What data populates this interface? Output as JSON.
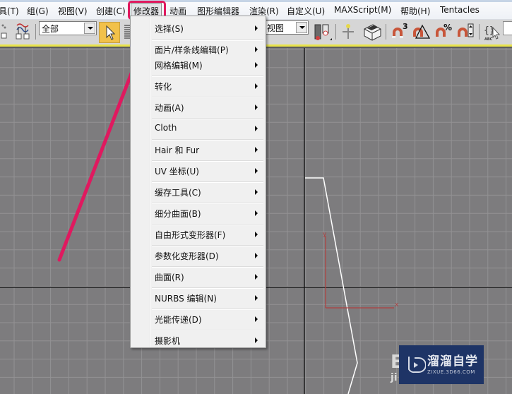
{
  "menubar": {
    "items": [
      {
        "label": "具(T)",
        "id": "tools"
      },
      {
        "label": "组(G)",
        "id": "group"
      },
      {
        "label": "视图(V)",
        "id": "views"
      },
      {
        "label": "创建(C)",
        "id": "create"
      },
      {
        "label": "修改器",
        "id": "modifiers",
        "active": true
      },
      {
        "label": "动画",
        "id": "animation"
      },
      {
        "label": "图形编辑器",
        "id": "graph-editors"
      },
      {
        "label": "渲染(R)",
        "id": "rendering"
      },
      {
        "label": "自定义(U)",
        "id": "customize"
      },
      {
        "label": "MAXScript(M)",
        "id": "maxscript"
      },
      {
        "label": "帮助(H)",
        "id": "help"
      },
      {
        "label": "Tentacles",
        "id": "tentacles"
      }
    ]
  },
  "toolbar": {
    "selection_filter": "全部",
    "reference_coord": "视图",
    "icons": [
      "select-and-link-icon",
      "select-object-icon",
      "selection-list-icon",
      "use-pivot-center-icon",
      "select-and-manipulate-icon",
      "keyboard-shortcut-override-icon",
      "snaps-toggle-3-icon",
      "angle-snap-icon",
      "percent-snap-icon",
      "spinner-snap-icon",
      "edit-named-selection-icon"
    ],
    "snap_label": "3",
    "percent_label": "%"
  },
  "context_menu": {
    "items": [
      {
        "label": "选择(S)",
        "submenu": true
      },
      {
        "label": "面片/样条线编辑(P)",
        "submenu": true
      },
      {
        "label": "网格编辑(M)",
        "submenu": true
      },
      {
        "label": "转化",
        "submenu": true
      },
      {
        "label": "动画(A)",
        "submenu": true
      },
      {
        "label": "Cloth",
        "submenu": true
      },
      {
        "label": "Hair 和 Fur",
        "submenu": true
      },
      {
        "label": "UV 坐标(U)",
        "submenu": true
      },
      {
        "label": "缓存工具(C)",
        "submenu": true
      },
      {
        "label": "细分曲面(B)",
        "submenu": true
      },
      {
        "label": "自由形式变形器(F)",
        "submenu": true
      },
      {
        "label": "参数化变形器(D)",
        "submenu": true
      },
      {
        "label": "曲面(R)",
        "submenu": true
      },
      {
        "label": "NURBS 编辑(N)",
        "submenu": true
      },
      {
        "label": "光能传递(D)",
        "submenu": true
      },
      {
        "label": "摄影机",
        "submenu": true
      }
    ]
  },
  "viewport": {
    "axis_x_label": "x",
    "axis_y_label": "y",
    "annotation_color": "#e0195f"
  },
  "watermark": {
    "title": "溜溜自学",
    "subtitle": "ZIXUE.3D66.COM"
  }
}
